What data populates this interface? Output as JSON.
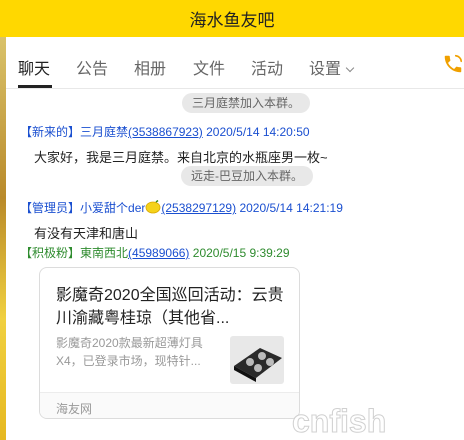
{
  "window": {
    "title": "海水鱼友吧"
  },
  "tabs": [
    {
      "label": "聊天"
    },
    {
      "label": "公告"
    },
    {
      "label": "相册"
    },
    {
      "label": "文件"
    },
    {
      "label": "活动"
    },
    {
      "label": "设置"
    }
  ],
  "messages": {
    "sys1": "三月庭禁加入本群。",
    "m1": {
      "role": "【新来的】",
      "name": "三月庭禁",
      "uid": "(3538867923)",
      "time": "2020/5/14 14:20:50",
      "text": "大家好，我是三月庭禁。来自北京的水瓶座男一枚~"
    },
    "sys2": "远走-巴豆加入本群。",
    "m2": {
      "role": "【管理员】",
      "name": "小爱甜个der",
      "uid": "(2538297129)",
      "time": "2020/5/14 14:21:19",
      "text": "有没有天津和唐山"
    },
    "m3": {
      "role": "【积极粉】",
      "name": "東南西北",
      "uid": "(45989066)",
      "time": "2020/5/15 9:39:29"
    }
  },
  "card": {
    "title": "影魔奇2020全国巡回活动：云贵川渝藏粤桂琼（其他省...",
    "desc": "影魔奇2020款最新超薄灯具X4，已登录市场，现特针...",
    "source": "海友网"
  },
  "watermark": {
    "text": "cnfish"
  },
  "colors": {
    "titlebar": "#ffd800",
    "link_blue": "#1a4fd0",
    "active_green": "#2e8b2e",
    "phone_icon": "#f0a000"
  }
}
